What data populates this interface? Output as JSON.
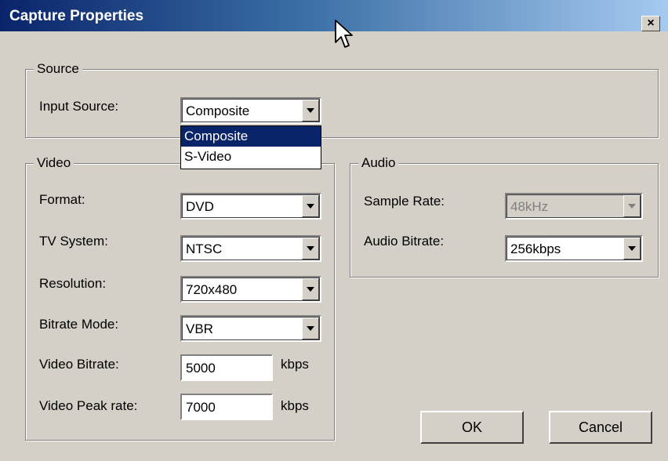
{
  "window": {
    "title": "Capture Properties",
    "close_glyph": "×"
  },
  "source": {
    "legend": "Source",
    "input_source_label": "Input Source:",
    "input_source_value": "Composite",
    "options": [
      "Composite",
      "S-Video"
    ]
  },
  "video": {
    "legend": "Video",
    "format_label": "Format:",
    "format_value": "DVD",
    "tv_system_label": "TV System:",
    "tv_system_value": "NTSC",
    "resolution_label": "Resolution:",
    "resolution_value": "720x480",
    "bitrate_mode_label": "Bitrate Mode:",
    "bitrate_mode_value": "VBR",
    "video_bitrate_label": "Video Bitrate:",
    "video_bitrate_value": "5000",
    "video_bitrate_unit": "kbps",
    "video_peak_label": "Video Peak rate:",
    "video_peak_value": "7000",
    "video_peak_unit": "kbps"
  },
  "audio": {
    "legend": "Audio",
    "sample_rate_label": "Sample Rate:",
    "sample_rate_value": "48kHz",
    "audio_bitrate_label": "Audio Bitrate:",
    "audio_bitrate_value": "256kbps"
  },
  "buttons": {
    "ok": "OK",
    "cancel": "Cancel"
  }
}
